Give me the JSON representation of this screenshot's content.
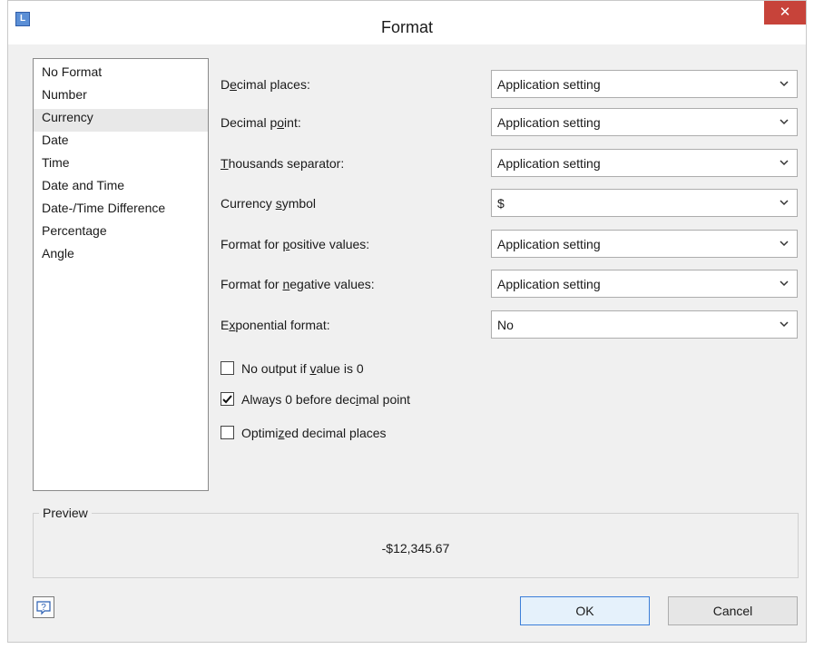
{
  "window": {
    "title": "Format",
    "app_icon_letter": "L",
    "close_glyph": "✕"
  },
  "format_list": {
    "items": [
      {
        "label": "No Format"
      },
      {
        "label": "Number"
      },
      {
        "label": "Currency",
        "selected": true
      },
      {
        "label": "Date"
      },
      {
        "label": "Time"
      },
      {
        "label": "Date and Time"
      },
      {
        "label": "Date-/Time Difference"
      },
      {
        "label": "Percentage"
      },
      {
        "label": "Angle"
      }
    ]
  },
  "settings": {
    "decimal_places": {
      "label_pre": "D",
      "label_u": "e",
      "label_post": "cimal places:",
      "value": "Application setting"
    },
    "decimal_point": {
      "label_pre": "Decimal p",
      "label_u": "o",
      "label_post": "int:",
      "value": "Application setting"
    },
    "thousands_separator": {
      "label_pre": "",
      "label_u": "T",
      "label_post": "housands separator:",
      "value": "Application setting"
    },
    "currency_symbol": {
      "label_pre": "Currency ",
      "label_u": "s",
      "label_post": "ymbol",
      "value": "$"
    },
    "positive_format": {
      "label_pre": "Format for ",
      "label_u": "p",
      "label_post": "ositive values:",
      "value": "Application setting"
    },
    "negative_format": {
      "label_pre": "Format for ",
      "label_u": "n",
      "label_post": "egative values:",
      "value": "Application setting"
    },
    "exponential_format": {
      "label_pre": "E",
      "label_u": "x",
      "label_post": "ponential format:",
      "value": "No"
    }
  },
  "checkboxes": {
    "no_output_zero": {
      "label_pre": "No output if ",
      "label_u": "v",
      "label_post": "alue is 0",
      "checked": false
    },
    "always_zero": {
      "label_pre": "Always 0 before dec",
      "label_u": "i",
      "label_post": "mal point",
      "checked": true
    },
    "optimized": {
      "label_pre": "Optimi",
      "label_u": "z",
      "label_post": "ed decimal places",
      "checked": false
    }
  },
  "preview": {
    "legend": "Preview",
    "value": "-$12,345.67"
  },
  "buttons": {
    "ok": "OK",
    "cancel": "Cancel",
    "help_icon": "question-bubble-icon"
  },
  "colors": {
    "close_button": "#c7433a",
    "ok_border": "#3c7fd9"
  }
}
